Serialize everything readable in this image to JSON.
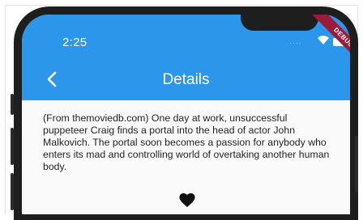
{
  "status_bar": {
    "time": "2:25",
    "debug_label": "DEBUG"
  },
  "app_bar": {
    "title": "Details"
  },
  "details": {
    "overview": "(From themoviedb.com) One day at work, unsuccessful puppeteer Craig finds a portal into the head of actor John Malkovich. The portal soon becomes a passion for anybody who enters its mad and controlling world of overtaking another human body."
  },
  "colors": {
    "app_bar": "#2b96ea",
    "debug_ribbon": "#9b1c39",
    "device": "#1e1e1e"
  },
  "icons": {
    "back": "chevron-left-icon",
    "favorite": "heart-icon",
    "wifi": "wifi-icon",
    "battery": "battery-icon"
  }
}
